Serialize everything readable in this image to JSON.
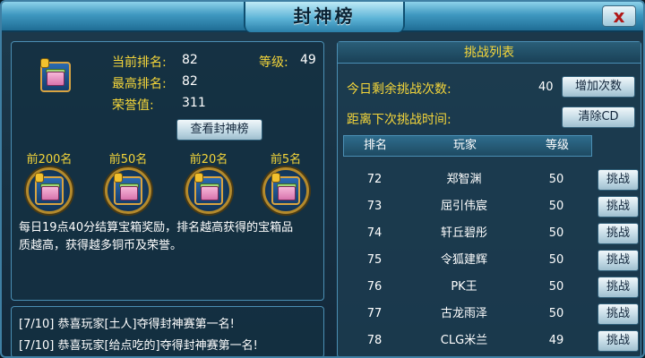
{
  "window": {
    "title": "封神榜",
    "close_label": "x"
  },
  "left": {
    "faded_header": "",
    "stats": {
      "current_rank_label": "当前排名:",
      "current_rank_value": "82",
      "level_label": "等级:",
      "level_value": "49",
      "best_rank_label": "最高排名:",
      "best_rank_value": "82",
      "honor_label": "荣誉值:",
      "honor_value": "311"
    },
    "view_button": "查看封神榜",
    "rewards": [
      {
        "label": "前200名"
      },
      {
        "label": "前50名"
      },
      {
        "label": "前20名"
      },
      {
        "label": "前5名"
      }
    ],
    "description_line1": "每日19点40分结算宝箱奖励，排名越高获得的宝箱品",
    "description_line2": "质越高，获得越多铜币及荣誉。"
  },
  "news": [
    {
      "text": "[7/10]  恭喜玩家[土人]夺得封神赛第一名!"
    },
    {
      "text": "[7/10]  恭喜玩家[给点吃的]夺得封神赛第一名!"
    }
  ],
  "right": {
    "header": "挑战列表",
    "remaining_label": "今日剩余挑战次数:",
    "remaining_value": "40",
    "add_button": "增加次数",
    "cooldown_label": "距离下次挑战时间:",
    "clear_button": "清除CD",
    "columns": {
      "rank": "排名",
      "player": "玩家",
      "level": "等级"
    },
    "challenge_button": "挑战",
    "rows": [
      {
        "rank": "72",
        "player": "郑智渊",
        "level": "50"
      },
      {
        "rank": "73",
        "player": "屈引伟宸",
        "level": "50"
      },
      {
        "rank": "74",
        "player": "轩丘碧彤",
        "level": "50"
      },
      {
        "rank": "75",
        "player": "令狐建辉",
        "level": "50"
      },
      {
        "rank": "76",
        "player": "PK王",
        "level": "50"
      },
      {
        "rank": "77",
        "player": "古龙雨泽",
        "level": "50"
      },
      {
        "rank": "78",
        "player": "CLG米兰",
        "level": "49"
      }
    ]
  },
  "colors": {
    "accent_gold": "#f5d63a",
    "panel": "#143042",
    "border": "#4b8fb4"
  },
  "icons": {
    "chest": "treasure-chest-icon",
    "lock": "lock-icon"
  }
}
